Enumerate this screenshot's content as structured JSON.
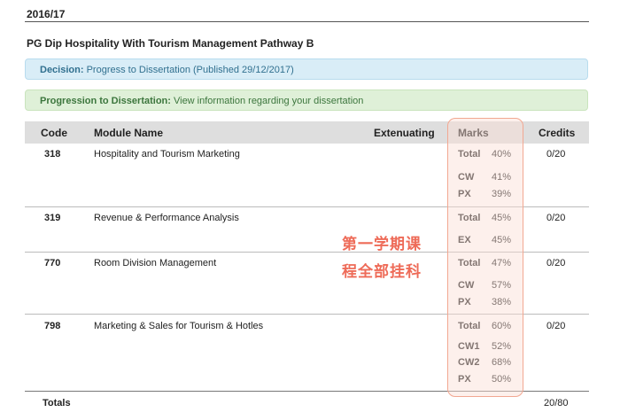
{
  "year": "2016/17",
  "program": "PG Dip Hospitality With Tourism Management Pathway B",
  "decision": {
    "label": "Decision:",
    "text": "Progress to Dissertation (Published 29/12/2017)"
  },
  "progression": {
    "label": "Progression to Dissertation:",
    "text": "View information regarding your dissertation"
  },
  "headers": {
    "code": "Code",
    "module": "Module Name",
    "extenuating": "Extenuating",
    "marks": "Marks",
    "credits": "Credits"
  },
  "modules": [
    {
      "code": "318",
      "name": "Hospitality and Tourism Marketing",
      "credits": "0/20",
      "marks": [
        {
          "label": "Total",
          "value": "40%"
        },
        {
          "label": "CW",
          "value": "41%"
        },
        {
          "label": "PX",
          "value": "39%"
        }
      ]
    },
    {
      "code": "319",
      "name": "Revenue & Performance Analysis",
      "credits": "0/20",
      "marks": [
        {
          "label": "Total",
          "value": "45%"
        },
        {
          "label": "EX",
          "value": "45%"
        }
      ]
    },
    {
      "code": "770",
      "name": "Room Division Management",
      "credits": "0/20",
      "marks": [
        {
          "label": "Total",
          "value": "47%"
        },
        {
          "label": "CW",
          "value": "57%"
        },
        {
          "label": "PX",
          "value": "38%"
        }
      ]
    },
    {
      "code": "798",
      "name": "Marketing & Sales for Tourism & Hotles",
      "credits": "0/20",
      "marks": [
        {
          "label": "Total",
          "value": "60%"
        },
        {
          "label": "CW1",
          "value": "52%"
        },
        {
          "label": "CW2",
          "value": "68%"
        },
        {
          "label": "PX",
          "value": "50%"
        }
      ]
    }
  ],
  "totals": {
    "label": "Totals",
    "credits": "20/80"
  },
  "annotation": {
    "line1": "第一学期课",
    "line2": "程全部挂科",
    "color": "#ee6b58"
  }
}
